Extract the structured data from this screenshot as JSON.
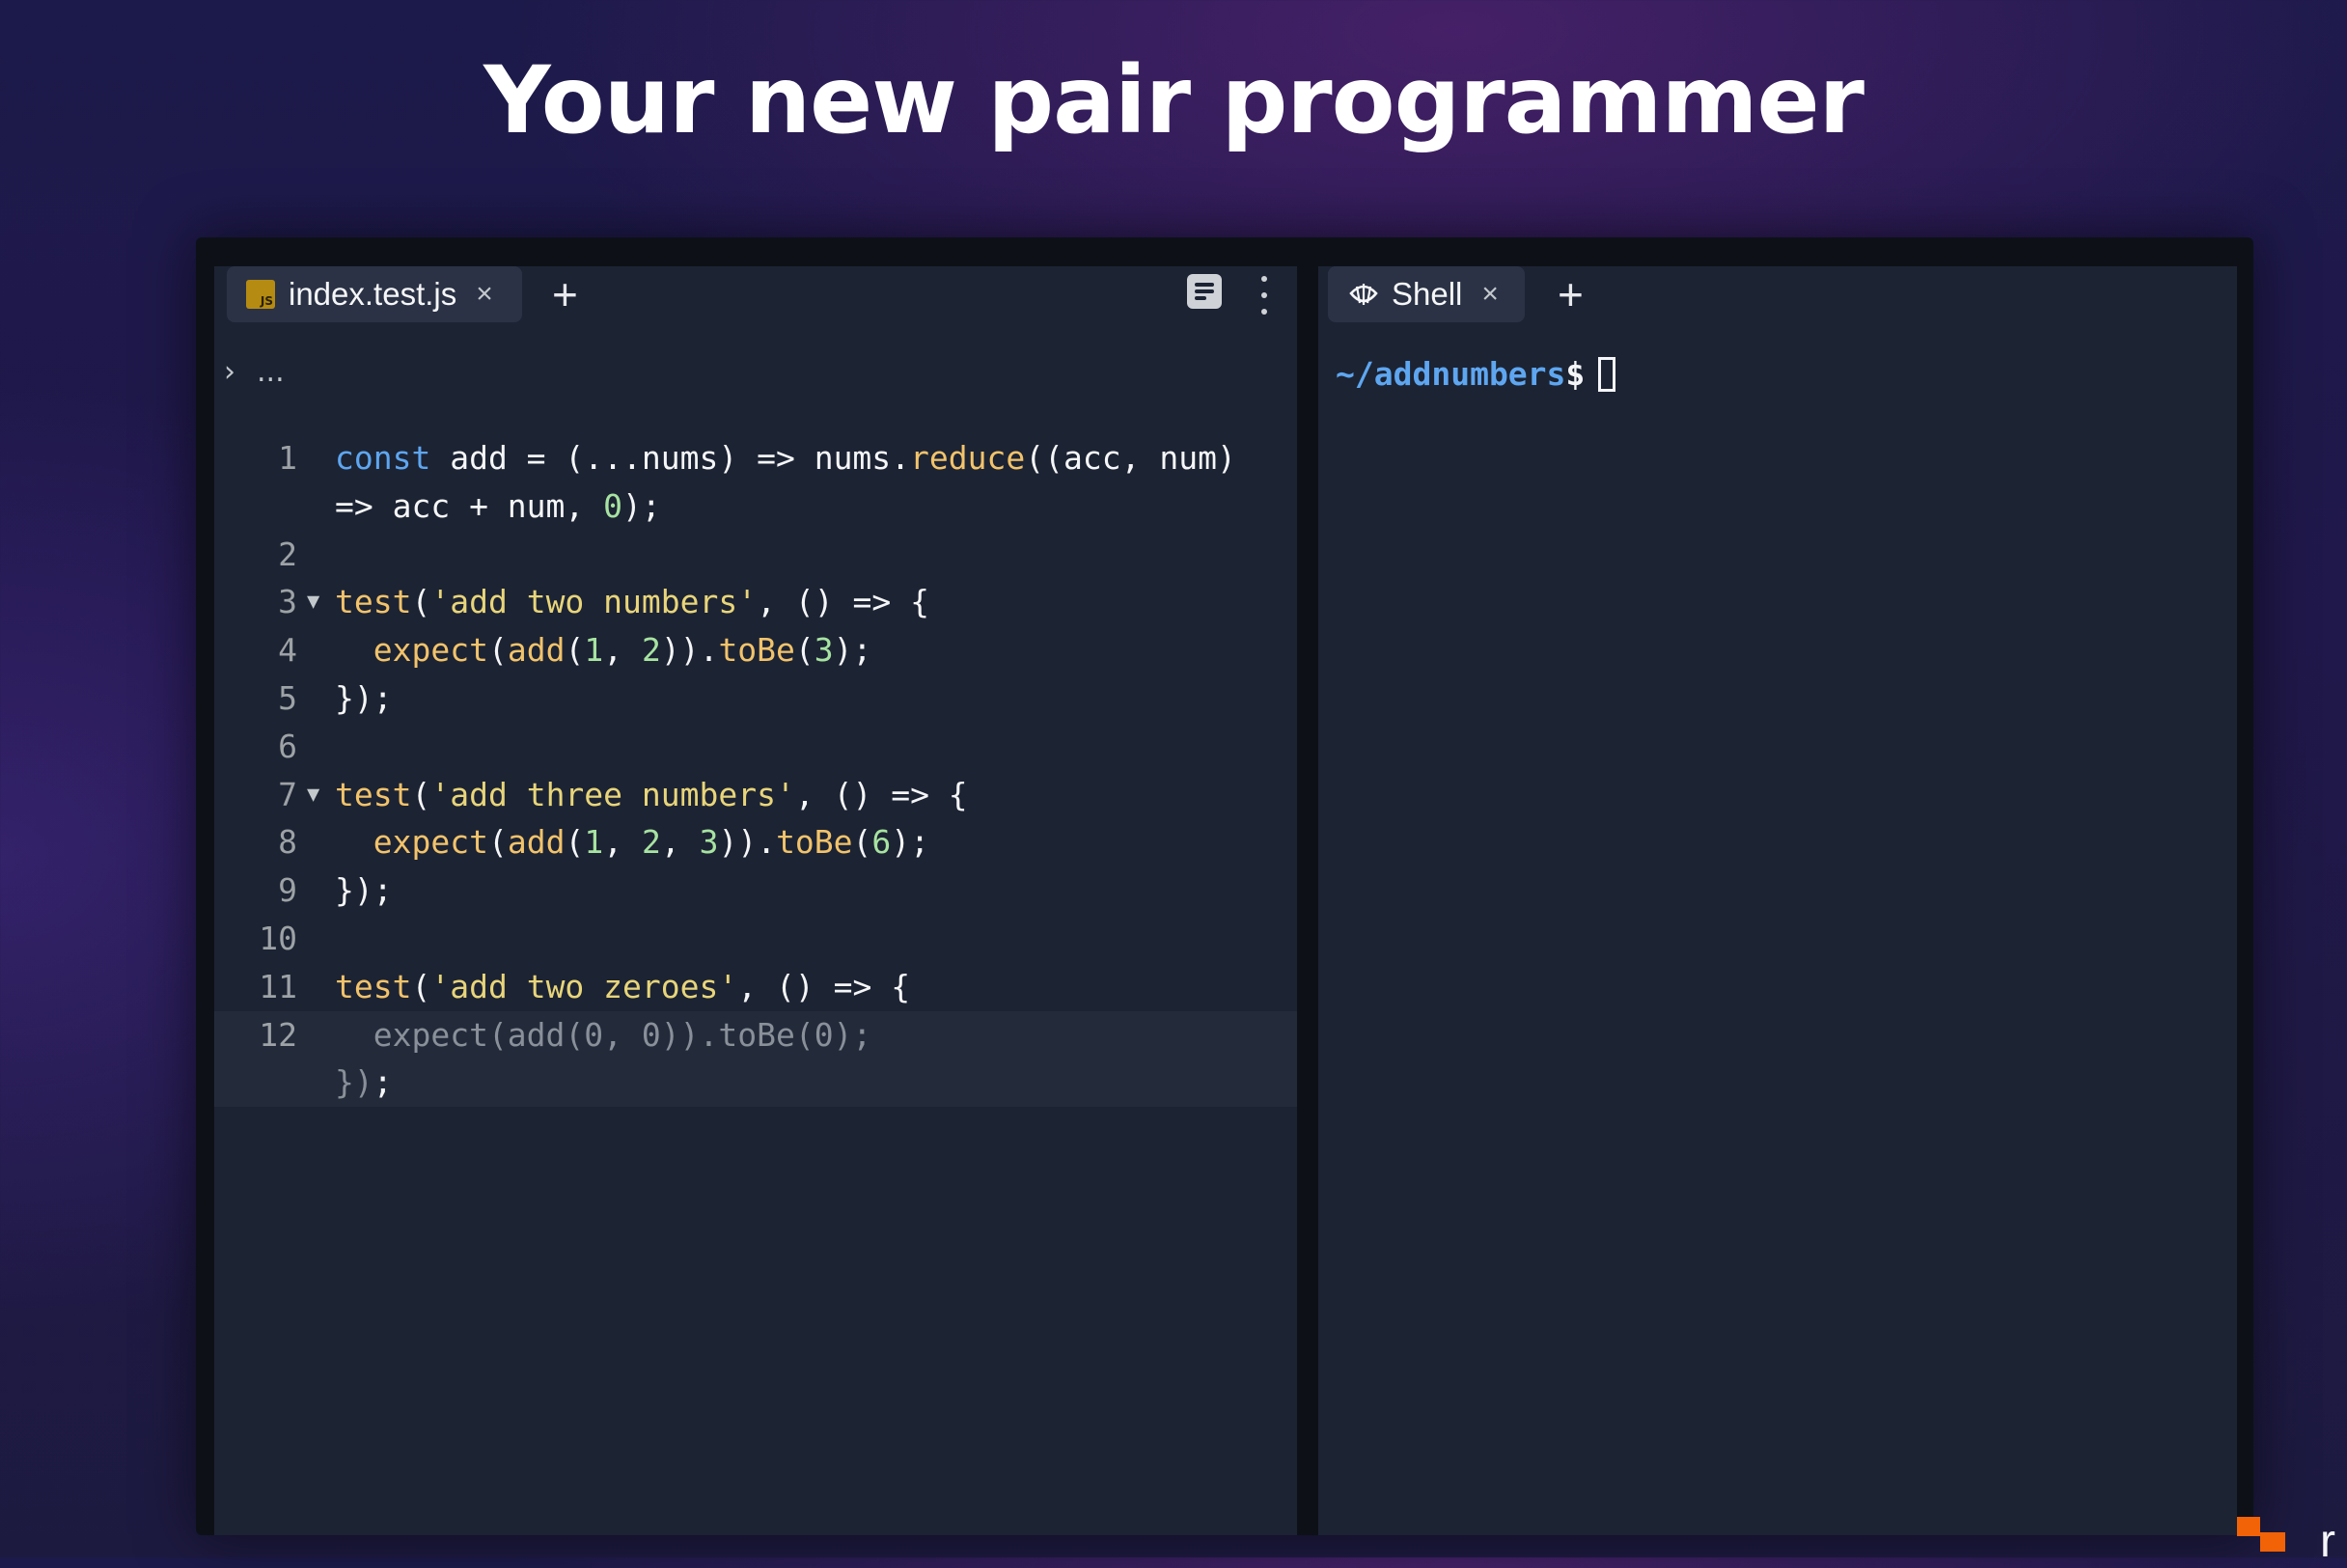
{
  "headline": "Your new pair programmer",
  "editor": {
    "tab": {
      "filename": "index.test.js",
      "close": "×"
    },
    "new_tab": "+",
    "breadcrumb": {
      "chevron": "›",
      "ellipsis": "..."
    },
    "lines": [
      {
        "n": "1",
        "fold": false,
        "ghost": false,
        "current": false,
        "segments": [
          [
            "kw",
            "const"
          ],
          [
            "p",
            " add = (...nums) => nums."
          ],
          [
            "fn",
            "reduce"
          ],
          [
            "p",
            "((acc, num)"
          ]
        ]
      },
      {
        "n": "",
        "fold": false,
        "ghost": false,
        "current": false,
        "segments": [
          [
            "p",
            "=> acc + num, "
          ],
          [
            "num",
            "0"
          ],
          [
            "p",
            ");"
          ]
        ]
      },
      {
        "n": "2",
        "fold": false,
        "ghost": false,
        "current": false,
        "segments": []
      },
      {
        "n": "3",
        "fold": true,
        "ghost": false,
        "current": false,
        "segments": [
          [
            "fn",
            "test"
          ],
          [
            "p",
            "("
          ],
          [
            "str",
            "'add two numbers'"
          ],
          [
            "p",
            ", () => {"
          ]
        ]
      },
      {
        "n": "4",
        "fold": false,
        "ghost": false,
        "current": false,
        "segments": [
          [
            "p",
            "  "
          ],
          [
            "fn",
            "expect"
          ],
          [
            "p",
            "("
          ],
          [
            "fn",
            "add"
          ],
          [
            "p",
            "("
          ],
          [
            "num",
            "1"
          ],
          [
            "p",
            ", "
          ],
          [
            "num",
            "2"
          ],
          [
            "p",
            "))."
          ],
          [
            "fn",
            "toBe"
          ],
          [
            "p",
            "("
          ],
          [
            "num",
            "3"
          ],
          [
            "p",
            ");"
          ]
        ]
      },
      {
        "n": "5",
        "fold": false,
        "ghost": false,
        "current": false,
        "segments": [
          [
            "p",
            "});"
          ]
        ]
      },
      {
        "n": "6",
        "fold": false,
        "ghost": false,
        "current": false,
        "segments": []
      },
      {
        "n": "7",
        "fold": true,
        "ghost": false,
        "current": false,
        "segments": [
          [
            "fn",
            "test"
          ],
          [
            "p",
            "("
          ],
          [
            "str",
            "'add three numbers'"
          ],
          [
            "p",
            ", () => {"
          ]
        ]
      },
      {
        "n": "8",
        "fold": false,
        "ghost": false,
        "current": false,
        "segments": [
          [
            "p",
            "  "
          ],
          [
            "fn",
            "expect"
          ],
          [
            "p",
            "("
          ],
          [
            "fn",
            "add"
          ],
          [
            "p",
            "("
          ],
          [
            "num",
            "1"
          ],
          [
            "p",
            ", "
          ],
          [
            "num",
            "2"
          ],
          [
            "p",
            ", "
          ],
          [
            "num",
            "3"
          ],
          [
            "p",
            "))."
          ],
          [
            "fn",
            "toBe"
          ],
          [
            "p",
            "("
          ],
          [
            "num",
            "6"
          ],
          [
            "p",
            ");"
          ]
        ]
      },
      {
        "n": "9",
        "fold": false,
        "ghost": false,
        "current": false,
        "segments": [
          [
            "p",
            "});"
          ]
        ]
      },
      {
        "n": "10",
        "fold": false,
        "ghost": false,
        "current": false,
        "segments": []
      },
      {
        "n": "11",
        "fold": false,
        "ghost": false,
        "current": false,
        "segments": [
          [
            "fn",
            "test"
          ],
          [
            "p",
            "("
          ],
          [
            "str",
            "'add two zeroes'"
          ],
          [
            "p",
            ", () => {"
          ]
        ]
      },
      {
        "n": "12",
        "fold": false,
        "ghost": true,
        "current": true,
        "segments": [
          [
            "ghost",
            "  expect(add(0, 0)).toBe(0);"
          ]
        ]
      },
      {
        "n": "",
        "fold": false,
        "ghost": true,
        "current": true,
        "segments": [
          [
            "ghost",
            "})"
          ],
          [
            "p",
            ";"
          ]
        ]
      }
    ]
  },
  "shell": {
    "tab": {
      "label": "Shell",
      "close": "×"
    },
    "new_tab": "+",
    "prompt_path": "~/addnumbers",
    "prompt_symbol": "$"
  },
  "brand": {
    "letter": "r",
    "color": "#f26207"
  },
  "colors": {
    "keyword": "#5ea6f0",
    "function": "#f2c36b",
    "string": "#e8d57a",
    "number": "#a7e3a1",
    "pane": "#1c2333"
  }
}
